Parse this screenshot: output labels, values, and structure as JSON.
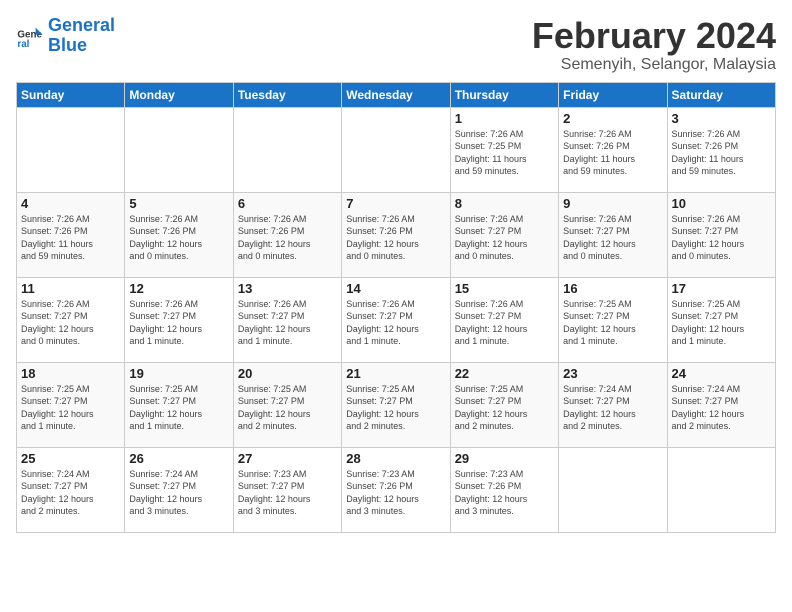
{
  "logo": {
    "line1": "General",
    "line2": "Blue"
  },
  "title": "February 2024",
  "subtitle": "Semenyih, Selangor, Malaysia",
  "days_header": [
    "Sunday",
    "Monday",
    "Tuesday",
    "Wednesday",
    "Thursday",
    "Friday",
    "Saturday"
  ],
  "weeks": [
    [
      {
        "day": "",
        "info": ""
      },
      {
        "day": "",
        "info": ""
      },
      {
        "day": "",
        "info": ""
      },
      {
        "day": "",
        "info": ""
      },
      {
        "day": "1",
        "info": "Sunrise: 7:26 AM\nSunset: 7:25 PM\nDaylight: 11 hours\nand 59 minutes."
      },
      {
        "day": "2",
        "info": "Sunrise: 7:26 AM\nSunset: 7:26 PM\nDaylight: 11 hours\nand 59 minutes."
      },
      {
        "day": "3",
        "info": "Sunrise: 7:26 AM\nSunset: 7:26 PM\nDaylight: 11 hours\nand 59 minutes."
      }
    ],
    [
      {
        "day": "4",
        "info": "Sunrise: 7:26 AM\nSunset: 7:26 PM\nDaylight: 11 hours\nand 59 minutes."
      },
      {
        "day": "5",
        "info": "Sunrise: 7:26 AM\nSunset: 7:26 PM\nDaylight: 12 hours\nand 0 minutes."
      },
      {
        "day": "6",
        "info": "Sunrise: 7:26 AM\nSunset: 7:26 PM\nDaylight: 12 hours\nand 0 minutes."
      },
      {
        "day": "7",
        "info": "Sunrise: 7:26 AM\nSunset: 7:26 PM\nDaylight: 12 hours\nand 0 minutes."
      },
      {
        "day": "8",
        "info": "Sunrise: 7:26 AM\nSunset: 7:27 PM\nDaylight: 12 hours\nand 0 minutes."
      },
      {
        "day": "9",
        "info": "Sunrise: 7:26 AM\nSunset: 7:27 PM\nDaylight: 12 hours\nand 0 minutes."
      },
      {
        "day": "10",
        "info": "Sunrise: 7:26 AM\nSunset: 7:27 PM\nDaylight: 12 hours\nand 0 minutes."
      }
    ],
    [
      {
        "day": "11",
        "info": "Sunrise: 7:26 AM\nSunset: 7:27 PM\nDaylight: 12 hours\nand 0 minutes."
      },
      {
        "day": "12",
        "info": "Sunrise: 7:26 AM\nSunset: 7:27 PM\nDaylight: 12 hours\nand 1 minute."
      },
      {
        "day": "13",
        "info": "Sunrise: 7:26 AM\nSunset: 7:27 PM\nDaylight: 12 hours\nand 1 minute."
      },
      {
        "day": "14",
        "info": "Sunrise: 7:26 AM\nSunset: 7:27 PM\nDaylight: 12 hours\nand 1 minute."
      },
      {
        "day": "15",
        "info": "Sunrise: 7:26 AM\nSunset: 7:27 PM\nDaylight: 12 hours\nand 1 minute."
      },
      {
        "day": "16",
        "info": "Sunrise: 7:25 AM\nSunset: 7:27 PM\nDaylight: 12 hours\nand 1 minute."
      },
      {
        "day": "17",
        "info": "Sunrise: 7:25 AM\nSunset: 7:27 PM\nDaylight: 12 hours\nand 1 minute."
      }
    ],
    [
      {
        "day": "18",
        "info": "Sunrise: 7:25 AM\nSunset: 7:27 PM\nDaylight: 12 hours\nand 1 minute."
      },
      {
        "day": "19",
        "info": "Sunrise: 7:25 AM\nSunset: 7:27 PM\nDaylight: 12 hours\nand 1 minute."
      },
      {
        "day": "20",
        "info": "Sunrise: 7:25 AM\nSunset: 7:27 PM\nDaylight: 12 hours\nand 2 minutes."
      },
      {
        "day": "21",
        "info": "Sunrise: 7:25 AM\nSunset: 7:27 PM\nDaylight: 12 hours\nand 2 minutes."
      },
      {
        "day": "22",
        "info": "Sunrise: 7:25 AM\nSunset: 7:27 PM\nDaylight: 12 hours\nand 2 minutes."
      },
      {
        "day": "23",
        "info": "Sunrise: 7:24 AM\nSunset: 7:27 PM\nDaylight: 12 hours\nand 2 minutes."
      },
      {
        "day": "24",
        "info": "Sunrise: 7:24 AM\nSunset: 7:27 PM\nDaylight: 12 hours\nand 2 minutes."
      }
    ],
    [
      {
        "day": "25",
        "info": "Sunrise: 7:24 AM\nSunset: 7:27 PM\nDaylight: 12 hours\nand 2 minutes."
      },
      {
        "day": "26",
        "info": "Sunrise: 7:24 AM\nSunset: 7:27 PM\nDaylight: 12 hours\nand 3 minutes."
      },
      {
        "day": "27",
        "info": "Sunrise: 7:23 AM\nSunset: 7:27 PM\nDaylight: 12 hours\nand 3 minutes."
      },
      {
        "day": "28",
        "info": "Sunrise: 7:23 AM\nSunset: 7:26 PM\nDaylight: 12 hours\nand 3 minutes."
      },
      {
        "day": "29",
        "info": "Sunrise: 7:23 AM\nSunset: 7:26 PM\nDaylight: 12 hours\nand 3 minutes."
      },
      {
        "day": "",
        "info": ""
      },
      {
        "day": "",
        "info": ""
      }
    ]
  ]
}
